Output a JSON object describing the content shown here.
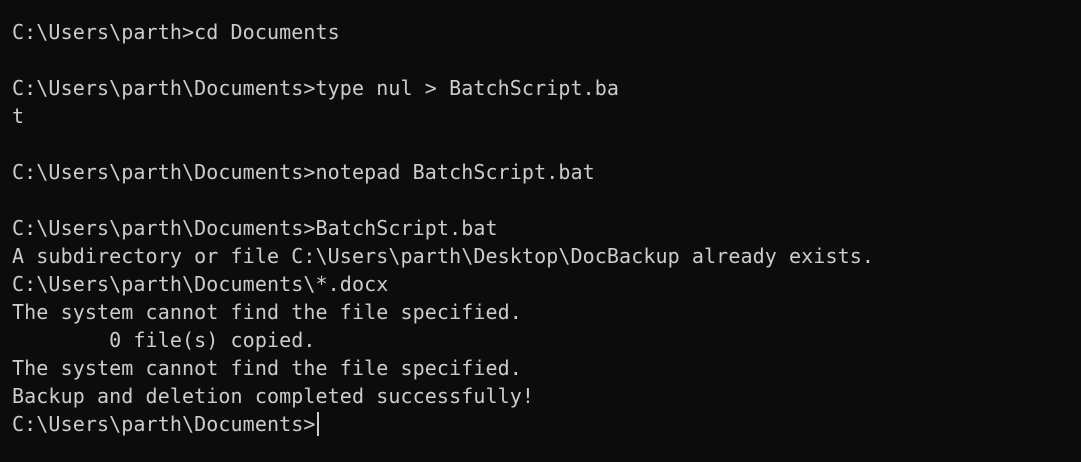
{
  "terminal": {
    "lines": [
      "C:\\Users\\parth>cd Documents",
      "",
      "C:\\Users\\parth\\Documents>type nul > BatchScript.ba",
      "t",
      "",
      "C:\\Users\\parth\\Documents>notepad BatchScript.bat",
      "",
      "C:\\Users\\parth\\Documents>BatchScript.bat",
      "A subdirectory or file C:\\Users\\parth\\Desktop\\DocBackup already exists.",
      "C:\\Users\\parth\\Documents\\*.docx",
      "The system cannot find the file specified.",
      "        0 file(s) copied.",
      "The system cannot find the file specified.",
      "Backup and deletion completed successfully!",
      "C:\\Users\\parth\\Documents>"
    ]
  },
  "colors": {
    "background": "#0c0c0c",
    "foreground": "#cccccc"
  }
}
